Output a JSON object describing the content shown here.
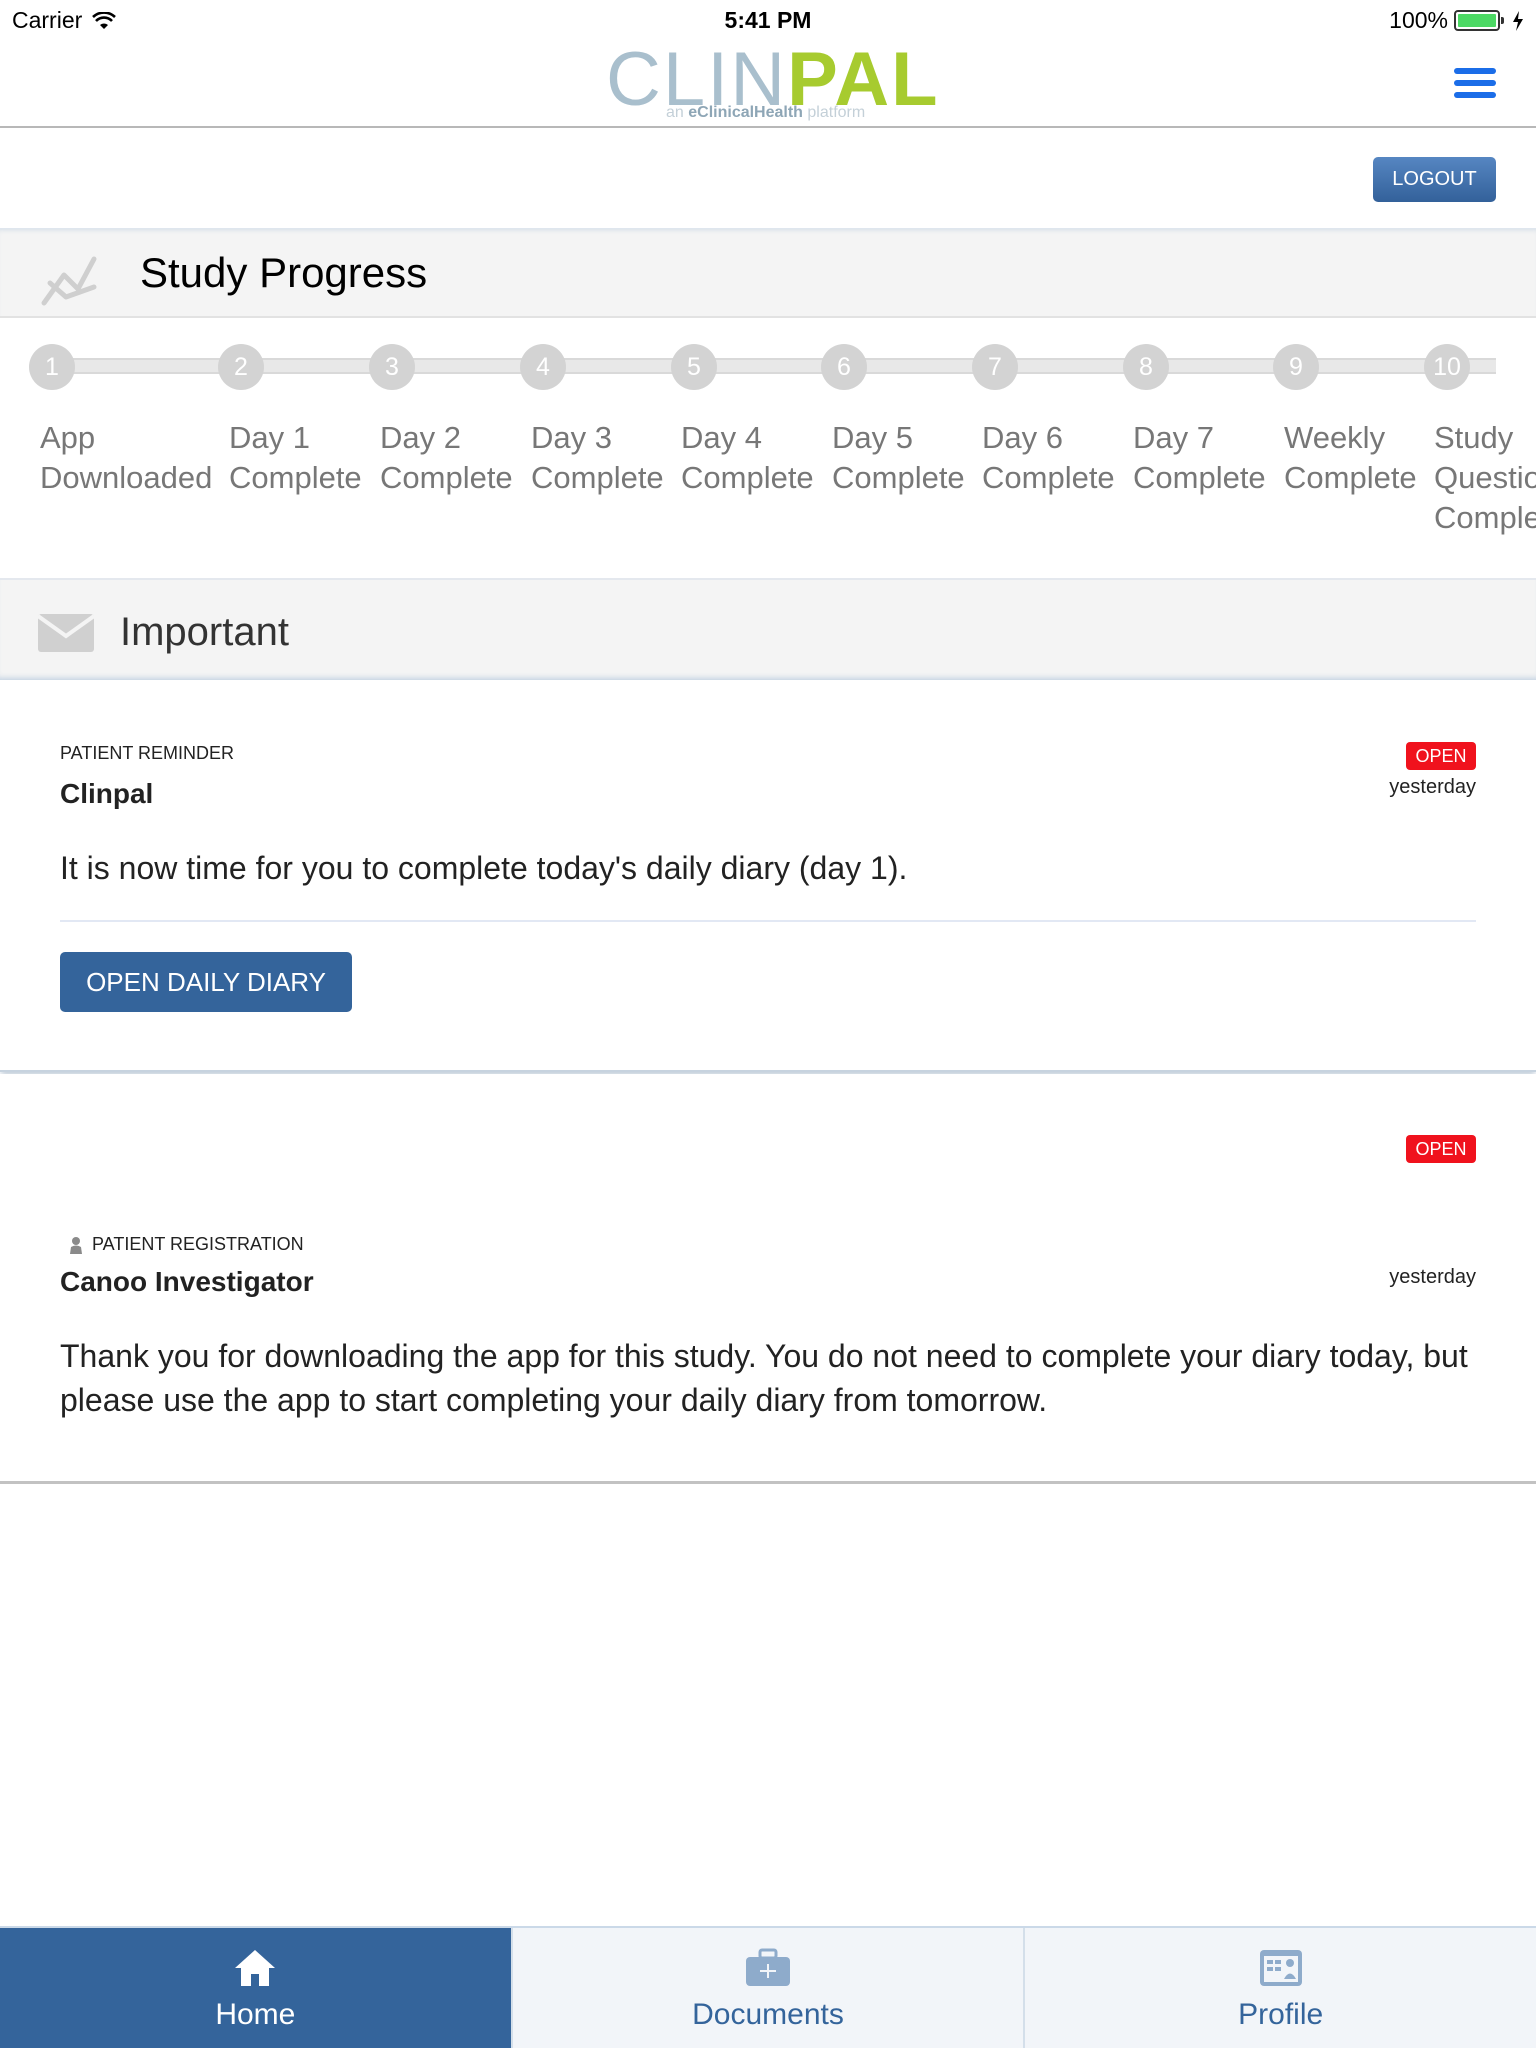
{
  "status_bar": {
    "carrier": "Carrier",
    "time": "5:41 PM",
    "battery": "100%"
  },
  "header": {
    "logo_part1": "CLIN",
    "logo_part2": "PAL",
    "tagline_pre": "an ",
    "tagline_brand": "eClinicalHealth",
    "tagline_post": " platform",
    "menu_icon": "hamburger-menu-icon"
  },
  "logout_label": "LOGOUT",
  "study_progress": {
    "title": "Study Progress",
    "icon": "chart-line-icon",
    "steps": [
      {
        "number": "1",
        "line1": "App",
        "line2": "Downloaded",
        "line3": ""
      },
      {
        "number": "2",
        "line1": "Day 1",
        "line2": "Complete",
        "line3": ""
      },
      {
        "number": "3",
        "line1": "Day 2",
        "line2": "Complete",
        "line3": ""
      },
      {
        "number": "4",
        "line1": "Day 3",
        "line2": "Complete",
        "line3": ""
      },
      {
        "number": "5",
        "line1": "Day 4",
        "line2": "Complete",
        "line3": ""
      },
      {
        "number": "6",
        "line1": "Day 5",
        "line2": "Complete",
        "line3": ""
      },
      {
        "number": "7",
        "line1": "Day 6",
        "line2": "Complete",
        "line3": ""
      },
      {
        "number": "8",
        "line1": "Day 7",
        "line2": "Complete",
        "line3": ""
      },
      {
        "number": "9",
        "line1": "Weekly",
        "line2": "Complete",
        "line3": ""
      },
      {
        "number": "10",
        "line1": "Study",
        "line2": "Questionnaire",
        "line3": "Complete"
      }
    ]
  },
  "important": {
    "title": "Important",
    "icon": "envelope-icon"
  },
  "messages": [
    {
      "category": "PATIENT REMINDER",
      "sender": "Clinpal",
      "status": "OPEN",
      "time": "yesterday",
      "body": "It is now time for you to complete today's daily diary (day 1).",
      "action_label": "OPEN DAILY DIARY"
    },
    {
      "category": "PATIENT REGISTRATION",
      "category_icon": "person-icon",
      "sender": "Canoo Investigator",
      "status": "OPEN",
      "time": "yesterday",
      "body": "Thank you for downloading the app for this study. You do not need to complete your diary today, but please use the app to start completing your daily diary from tomorrow."
    }
  ],
  "tabs": [
    {
      "label": "Home",
      "icon": "home-icon",
      "active": true
    },
    {
      "label": "Documents",
      "icon": "briefcase-icon",
      "active": false
    },
    {
      "label": "Profile",
      "icon": "id-card-icon",
      "active": false
    }
  ],
  "colors": {
    "primary": "#34649b",
    "badge_open": "#f0121d",
    "logo_light": "#a9bfcd",
    "logo_green": "#a7cb2f",
    "menu_blue": "#1b6de8",
    "step_gray": "#d3d3d3"
  }
}
